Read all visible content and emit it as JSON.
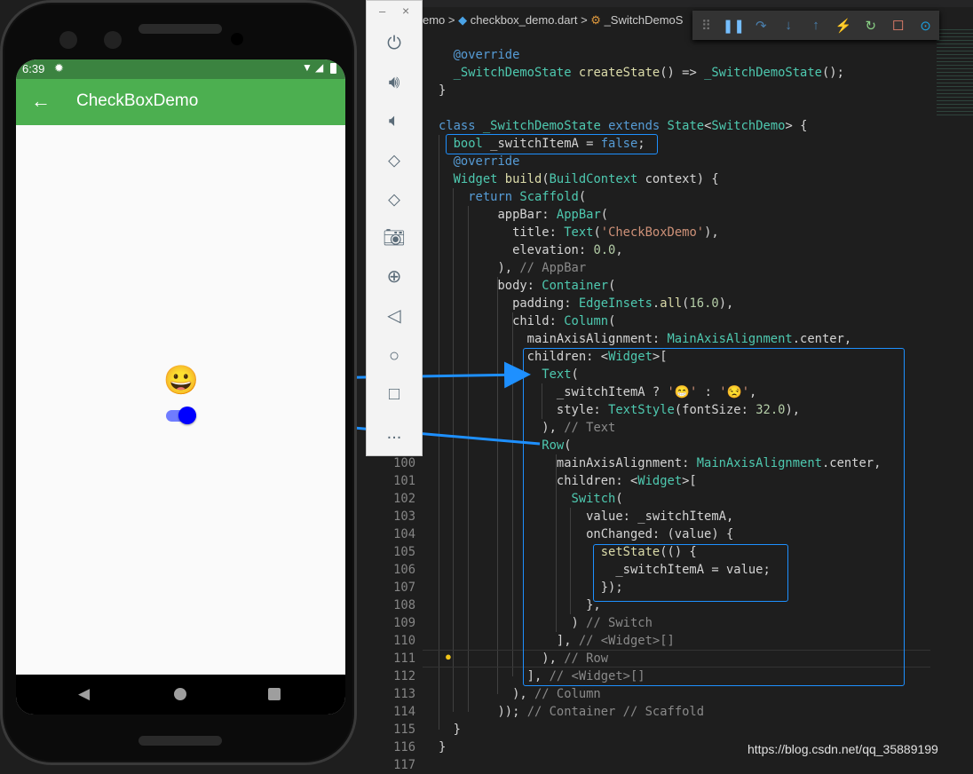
{
  "phone": {
    "status_time": "6:39",
    "app_title": "CheckBoxDemo",
    "emoji": "😀",
    "switch_on": true,
    "colors": {
      "appbar": "#4caf50",
      "statusbar": "#3b8340",
      "switch_thumb": "#0000ff",
      "switch_track": "#6f7cff"
    }
  },
  "emulator_toolbar": {
    "window_buttons": [
      "–",
      "×"
    ],
    "icons": [
      "power-icon",
      "volume-up-icon",
      "volume-down-icon",
      "rotate-left-icon",
      "rotate-right-icon",
      "camera-icon",
      "zoom-icon",
      "back-icon",
      "home-icon",
      "overview-icon",
      "more-icon"
    ],
    "more_label": "..."
  },
  "breadcrumb": {
    "items": [
      "emo",
      "checkbox_demo.dart",
      "_SwitchDemoS"
    ],
    "separator": ">"
  },
  "debug_toolbar": {
    "icons": [
      "drag-handle-icon",
      "pause-icon",
      "step-over-icon",
      "step-into-icon",
      "step-out-icon",
      "hot-reload-icon",
      "restart-icon",
      "stop-icon",
      "devtools-icon"
    ]
  },
  "editor": {
    "line_numbers": [
      "100",
      "101",
      "102",
      "103",
      "104",
      "105",
      "106",
      "107",
      "108",
      "109",
      "110",
      "111",
      "112",
      "113",
      "114",
      "115",
      "116",
      "117"
    ],
    "lines": [
      [
        [
          "  @override",
          "an"
        ]
      ],
      [
        [
          "  _SwitchDemoState",
          "ty"
        ],
        [
          " ",
          "id"
        ],
        [
          "createState",
          "fn"
        ],
        [
          "() => ",
          "id"
        ],
        [
          "_SwitchDemoState",
          "ty"
        ],
        [
          "();",
          "id"
        ]
      ],
      [
        [
          "}",
          "id"
        ]
      ],
      [
        [
          "",
          "id"
        ]
      ],
      [
        [
          "class",
          "kw"
        ],
        [
          " _SwitchDemoState ",
          "ty"
        ],
        [
          "extends",
          "kw"
        ],
        [
          " State",
          "ty"
        ],
        [
          "<",
          "id"
        ],
        [
          "SwitchDemo",
          "ty"
        ],
        [
          "> {",
          "id"
        ]
      ],
      [
        [
          "  bool",
          "ty"
        ],
        [
          " _switchItemA = ",
          "id"
        ],
        [
          "false",
          "kw"
        ],
        [
          ";",
          "id"
        ]
      ],
      [
        [
          "  @override",
          "an"
        ]
      ],
      [
        [
          "  Widget",
          "ty"
        ],
        [
          " ",
          "id"
        ],
        [
          "build",
          "fn"
        ],
        [
          "(",
          "id"
        ],
        [
          "BuildContext",
          "ty"
        ],
        [
          " context) {",
          "id"
        ]
      ],
      [
        [
          "    return",
          "kw"
        ],
        [
          " Scaffold",
          "ty"
        ],
        [
          "(",
          "id"
        ]
      ],
      [
        [
          "        appBar: ",
          "id"
        ],
        [
          "AppBar",
          "ty"
        ],
        [
          "(",
          "id"
        ]
      ],
      [
        [
          "          title: ",
          "id"
        ],
        [
          "Text",
          "ty"
        ],
        [
          "(",
          "id"
        ],
        [
          "'CheckBoxDemo'",
          "st"
        ],
        [
          "),",
          "id"
        ]
      ],
      [
        [
          "          elevation: ",
          "id"
        ],
        [
          "0.0",
          "nu"
        ],
        [
          ",",
          "id"
        ]
      ],
      [
        [
          "        ), ",
          "id"
        ],
        [
          "// AppBar",
          "cm"
        ]
      ],
      [
        [
          "        body: ",
          "id"
        ],
        [
          "Container",
          "ty"
        ],
        [
          "(",
          "id"
        ]
      ],
      [
        [
          "          padding: ",
          "id"
        ],
        [
          "EdgeInsets",
          "ty"
        ],
        [
          ".",
          "id"
        ],
        [
          "all",
          "fn"
        ],
        [
          "(",
          "id"
        ],
        [
          "16.0",
          "nu"
        ],
        [
          "),",
          "id"
        ]
      ],
      [
        [
          "          child: ",
          "id"
        ],
        [
          "Column",
          "ty"
        ],
        [
          "(",
          "id"
        ]
      ],
      [
        [
          "            mainAxisAlignment: ",
          "id"
        ],
        [
          "MainAxisAlignment",
          "ty"
        ],
        [
          ".center,",
          "id"
        ]
      ],
      [
        [
          "            children: <",
          "id"
        ],
        [
          "Widget",
          "ty"
        ],
        [
          ">[",
          "id"
        ]
      ],
      [
        [
          "              Text",
          "ty"
        ],
        [
          "(",
          "id"
        ]
      ],
      [
        [
          "                _switchItemA ? ",
          "id"
        ],
        [
          "'😁'",
          "st"
        ],
        [
          " : ",
          "id"
        ],
        [
          "'😒'",
          "st"
        ],
        [
          ",",
          "id"
        ]
      ],
      [
        [
          "                style: ",
          "id"
        ],
        [
          "TextStyle",
          "ty"
        ],
        [
          "(fontSize: ",
          "id"
        ],
        [
          "32.0",
          "nu"
        ],
        [
          "),",
          "id"
        ]
      ],
      [
        [
          "              ), ",
          "id"
        ],
        [
          "// Text",
          "cm"
        ]
      ],
      [
        [
          "              Row",
          "ty"
        ],
        [
          "(",
          "id"
        ]
      ],
      [
        [
          "                mainAxisAlignment: ",
          "id"
        ],
        [
          "MainAxisAlignment",
          "ty"
        ],
        [
          ".center,",
          "id"
        ]
      ],
      [
        [
          "                children: <",
          "id"
        ],
        [
          "Widget",
          "ty"
        ],
        [
          ">[",
          "id"
        ]
      ],
      [
        [
          "                  Switch",
          "ty"
        ],
        [
          "(",
          "id"
        ]
      ],
      [
        [
          "                    value: _switchItemA,",
          "id"
        ]
      ],
      [
        [
          "                    onChanged: (value) {",
          "id"
        ]
      ],
      [
        [
          "                      setState",
          "fn"
        ],
        [
          "(() {",
          "id"
        ]
      ],
      [
        [
          "                        _switchItemA = value;",
          "id"
        ]
      ],
      [
        [
          "                      });",
          "id"
        ]
      ],
      [
        [
          "                    },",
          "id"
        ]
      ],
      [
        [
          "                  ) ",
          "id"
        ],
        [
          "// Switch",
          "cm"
        ]
      ],
      [
        [
          "                ], ",
          "id"
        ],
        [
          "// <Widget>[]",
          "cm"
        ]
      ],
      [
        [
          "              ), ",
          "id"
        ],
        [
          "// Row",
          "cm"
        ]
      ],
      [
        [
          "            ], ",
          "id"
        ],
        [
          "// <Widget>[]",
          "cm"
        ]
      ],
      [
        [
          "          ), ",
          "id"
        ],
        [
          "// Column",
          "cm"
        ]
      ],
      [
        [
          "        )); ",
          "id"
        ],
        [
          "// Container // Scaffold",
          "cm"
        ]
      ],
      [
        [
          "  }",
          "id"
        ]
      ],
      [
        [
          "}",
          "id"
        ]
      ]
    ]
  },
  "watermark": "https://blog.csdn.net/qq_35889199"
}
